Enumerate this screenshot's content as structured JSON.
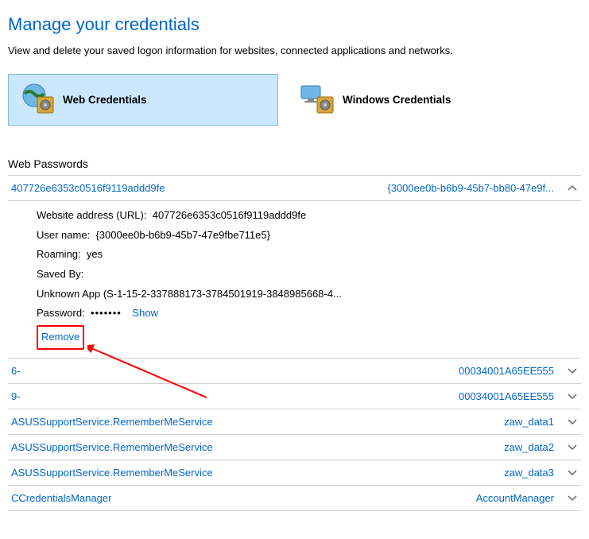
{
  "page": {
    "title": "Manage your credentials",
    "subtitle": "View and delete your saved logon information for websites, connected applications and networks."
  },
  "tabs": {
    "web_label": "Web Credentials",
    "windows_label": "Windows Credentials"
  },
  "section": {
    "title": "Web Passwords"
  },
  "expanded": {
    "site": "407726e6353c0516f9119addd9fe",
    "right": "{3000ee0b-b6b9-45b7-bb80-47e9f...",
    "url_label": "Website address (URL):",
    "url_value": "407726e6353c0516f9119addd9fe",
    "user_label": "User name:",
    "user_value": "{3000ee0b-b6b9-45b7-47e9fbe711e5}",
    "roaming_label": "Roaming:",
    "roaming_value": "yes",
    "savedby_label": "Saved By:",
    "savedby_value": "Unknown App (S-1-15-2-337888173-3784501919-3848985668-4...",
    "password_label": "Password:",
    "password_value": "•••••••",
    "show_label": "Show",
    "remove_label": "Remove"
  },
  "rows": [
    {
      "left": "6-",
      "right": "00034001A65EE555"
    },
    {
      "left": "9-",
      "right": "00034001A65EE555"
    },
    {
      "left": "ASUSSupportService.RememberMeService",
      "right": "zaw_data1"
    },
    {
      "left": "ASUSSupportService.RememberMeService",
      "right": "zaw_data2"
    },
    {
      "left": "ASUSSupportService.RememberMeService",
      "right": "zaw_data3"
    },
    {
      "left": "CCredentialsManager",
      "right": "AccountManager"
    }
  ]
}
